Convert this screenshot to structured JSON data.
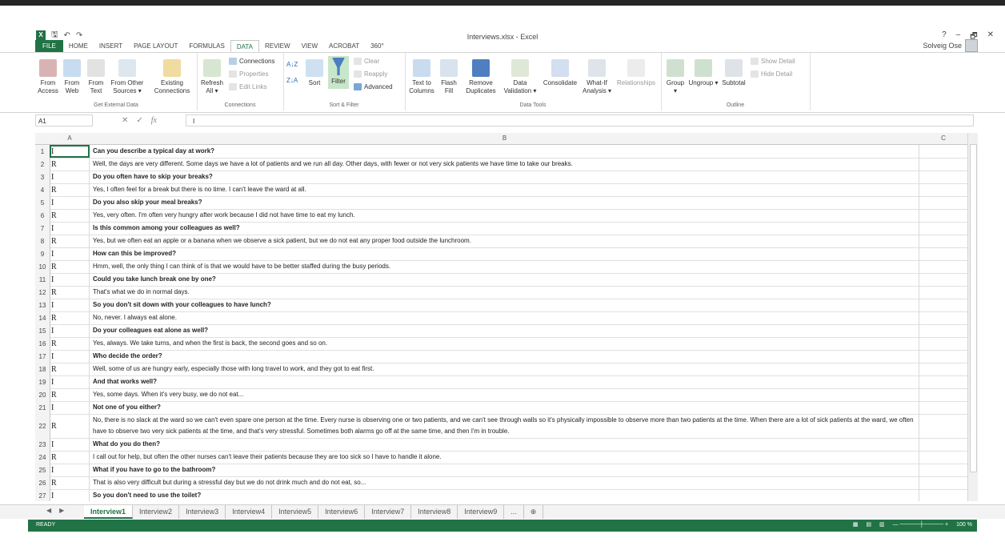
{
  "app": {
    "title": "Interviews.xlsx - Excel",
    "user": "Solveig Ose",
    "help": "?",
    "minimize": "–",
    "restore": "🗗",
    "close": "✕"
  },
  "qat": {
    "save": "🖫",
    "undo": "↶",
    "redo": "↷"
  },
  "tabs": [
    "FILE",
    "HOME",
    "INSERT",
    "PAGE LAYOUT",
    "FORMULAS",
    "DATA",
    "REVIEW",
    "VIEW",
    "ACROBAT",
    "360°"
  ],
  "ribbon": {
    "get_external": {
      "label": "Get External Data",
      "buttons": [
        "From Access",
        "From Web",
        "From Text",
        "From Other Sources ▾",
        "Existing Connections"
      ]
    },
    "connections": {
      "label": "Connections",
      "refresh": "Refresh All ▾",
      "items": [
        "Connections",
        "Properties",
        "Edit Links"
      ]
    },
    "sort_filter": {
      "label": "Sort & Filter",
      "sort": "Sort",
      "filter": "Filter",
      "items": [
        "Clear",
        "Reapply",
        "Advanced"
      ]
    },
    "data_tools": {
      "label": "Data Tools",
      "buttons": [
        "Text to Columns",
        "Flash Fill",
        "Remove Duplicates",
        "Data Validation ▾",
        "Consolidate",
        "What-If Analysis ▾",
        "Relationships"
      ]
    },
    "outline": {
      "label": "Outline",
      "buttons": [
        "Group ▾",
        "Ungroup ▾",
        "Subtotal"
      ],
      "items": [
        "Show Detail",
        "Hide Detail"
      ]
    }
  },
  "formula_bar": {
    "name_box": "A1",
    "content": "I",
    "fx": "fx"
  },
  "columns": [
    "A",
    "B",
    "C"
  ],
  "rows": [
    {
      "n": "1",
      "a": "I",
      "b": "Can you describe a typical day at work?"
    },
    {
      "n": "2",
      "a": "R",
      "b": "Well, the days are very different. Some days we have a lot of patients and we run all day. Other days, with fewer or not very sick patients we have time to take our breaks."
    },
    {
      "n": "3",
      "a": "I",
      "b": "Do you often have to skip your breaks?"
    },
    {
      "n": "4",
      "a": "R",
      "b": "Yes, I often feel for a break but there is no time. I can't leave the ward at all."
    },
    {
      "n": "5",
      "a": "I",
      "b": "Do you also skip your meal breaks?"
    },
    {
      "n": "6",
      "a": "R",
      "b": "Yes, very often. I'm often very hungry after work because I did not have time to eat my lunch."
    },
    {
      "n": "7",
      "a": "I",
      "b": "Is this common among your colleagues as well?"
    },
    {
      "n": "8",
      "a": "R",
      "b": "Yes, but we often eat an apple or a banana when we observe a sick patient, but we do not eat any proper food outside the lunchroom."
    },
    {
      "n": "9",
      "a": "I",
      "b": "How can this be improved?"
    },
    {
      "n": "10",
      "a": "R",
      "b": "Hmm, well, the only thing I can think of is that we would have to be better staffed during the busy periods."
    },
    {
      "n": "11",
      "a": "I",
      "b": "Could you take lunch break one by one?"
    },
    {
      "n": "12",
      "a": "R",
      "b": "That's what we do in normal days."
    },
    {
      "n": "13",
      "a": "I",
      "b": "So you don't sit down with your colleagues to have lunch?"
    },
    {
      "n": "14",
      "a": "R",
      "b": "No, never. I always eat alone."
    },
    {
      "n": "15",
      "a": "I",
      "b": "Do your colleagues eat alone as well?"
    },
    {
      "n": "16",
      "a": "R",
      "b": "Yes, always. We take turns, and when the first is back, the second goes and so on."
    },
    {
      "n": "17",
      "a": "I",
      "b": "Who decide the order?"
    },
    {
      "n": "18",
      "a": "R",
      "b": "Well, some of us are hungry early, especially those with long travel to work, and they got to eat first."
    },
    {
      "n": "19",
      "a": "I",
      "b": "And that works well?"
    },
    {
      "n": "20",
      "a": "R",
      "b": "Yes, some days. When it's very busy, we do not eat..."
    },
    {
      "n": "21",
      "a": "I",
      "b": "Not one of you either?"
    },
    {
      "n": "22",
      "a": "R",
      "b": "No, there is no slack at the ward so we can't even spare one person at the time. Every nurse is observing one or two patients, and we can't see through walls so it's physically impossible to observe more than two patients at the time. When there are a lot of sick patients at the ward, we often have to observe two very sick patients at the time, and that's very stressful. Sometimes both alarms go off at the same time, and then I'm in trouble."
    },
    {
      "n": "23",
      "a": "I",
      "b": "What do you do then?"
    },
    {
      "n": "24",
      "a": "R",
      "b": "I call out for help, but often the other nurses can't leave their patients because they are too sick so I have to handle it alone."
    },
    {
      "n": "25",
      "a": "I",
      "b": "What if you have to go to the bathroom?"
    },
    {
      "n": "26",
      "a": "R",
      "b": "That is also very difficult but during a stressful day but we do not drink much and do not eat, so..."
    },
    {
      "n": "27",
      "a": "I",
      "b": "So you don't need to use the toilet?"
    }
  ],
  "sheets": [
    "Interview1",
    "Interview2",
    "Interview3",
    "Interview4",
    "Interview5",
    "Interview6",
    "Interview7",
    "Interview8",
    "Interview9",
    "...",
    "⊕"
  ],
  "status": {
    "ready": "READY",
    "zoom": "100 %"
  },
  "colors": {
    "accent": "#217346"
  }
}
